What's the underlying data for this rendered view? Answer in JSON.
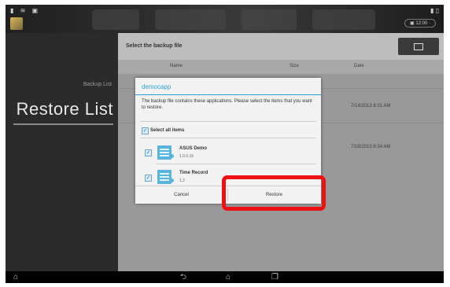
{
  "status_bar": {
    "left_icons": "▮ ≋ ▣",
    "right_icons": "▮ ▯",
    "pill_text": "▣ 12:00 ·"
  },
  "left_panel": {
    "subtitle": "Backup List",
    "title": "Restore List"
  },
  "main": {
    "header_title": "Select the backup file",
    "columns": [
      "Name",
      "Size",
      "Date"
    ],
    "rows": [
      {
        "date": "7/14/2013 8:31 AM"
      },
      {
        "date": "7/18/2013 8:34 AM"
      }
    ]
  },
  "dialog": {
    "title": "democapp",
    "message": "The backup file contains these applications. Please select the items that you want to restore.",
    "select_all_label": "Select all items",
    "apps": [
      {
        "name": "ASUS Demo",
        "version": "1.0.0.16"
      },
      {
        "name": "Time Record",
        "version": "1.2"
      }
    ],
    "cancel_label": "Cancel",
    "restore_label": "Restore"
  },
  "nav_bar": {
    "menu_icon": "⌂",
    "back_icon": "⮌",
    "home_icon": "⌂",
    "recent_icon": "❐"
  },
  "colors": {
    "accent": "#2aa0d6",
    "highlight": "#ee1111"
  }
}
